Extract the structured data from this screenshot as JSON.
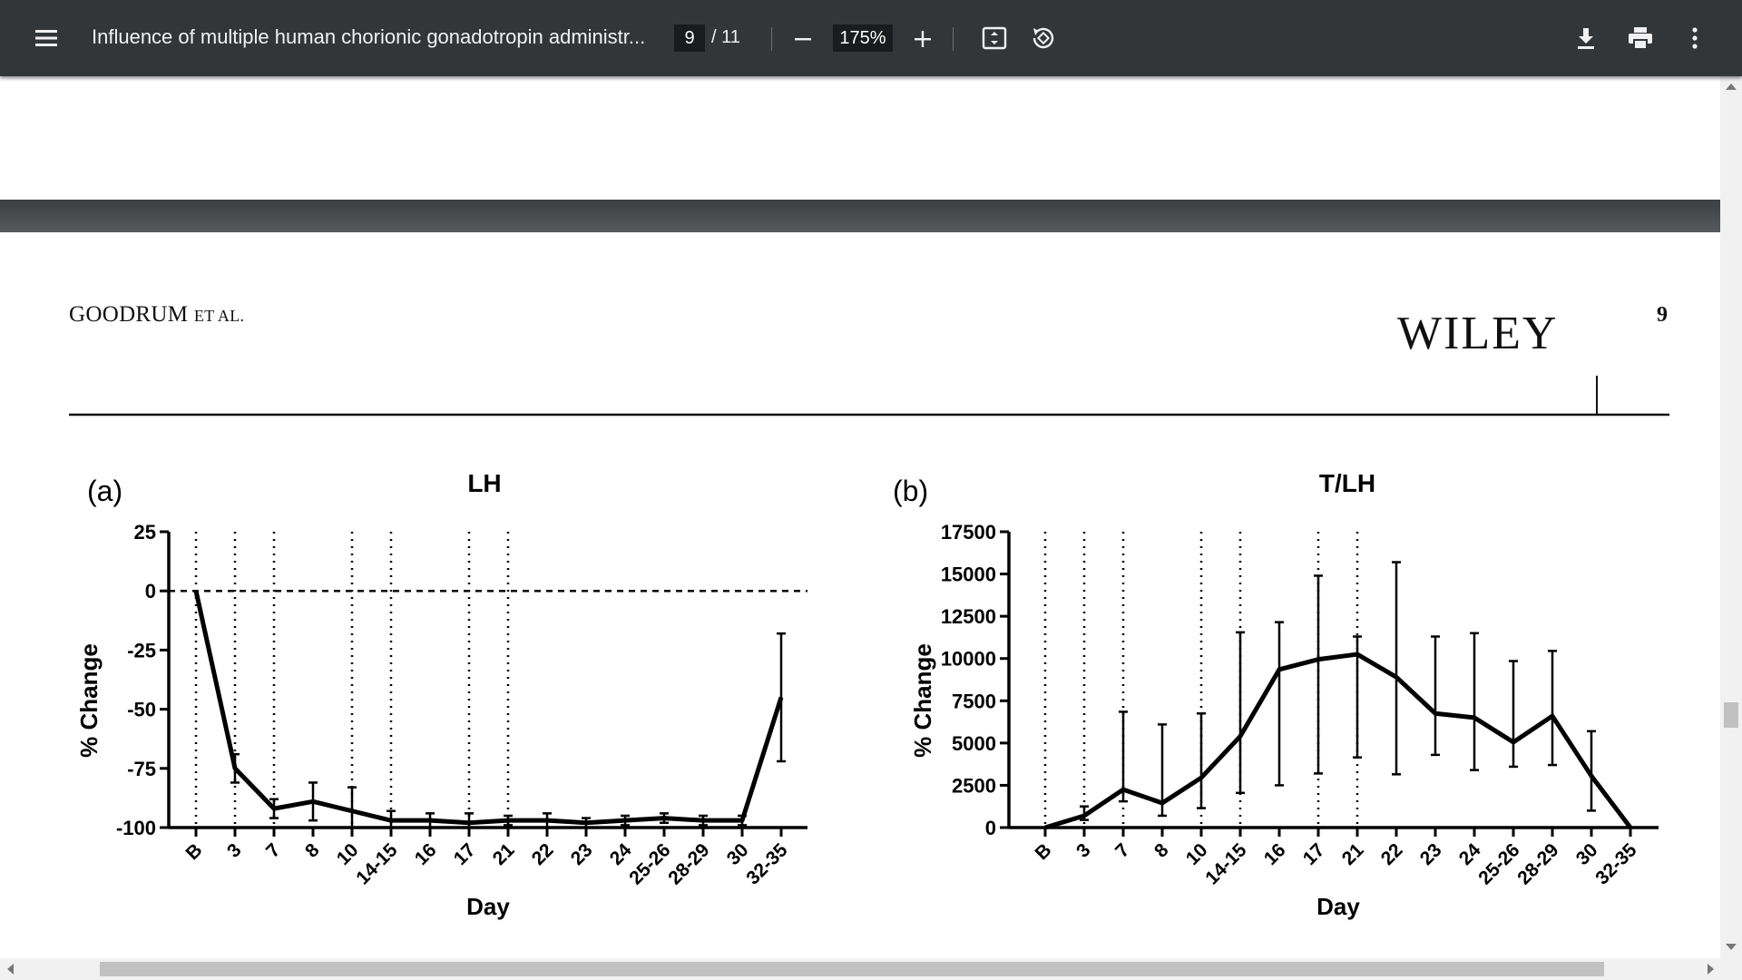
{
  "toolbar": {
    "title": "Influence of multiple human chorionic gonadotropin administr...",
    "page_current": "9",
    "page_total": "/ 11",
    "zoom": "175%",
    "menu_icon": "hamburger-menu-icon",
    "zoom_out_icon": "minus-icon",
    "zoom_in_icon": "plus-icon",
    "fit_icon": "fit-to-page-icon",
    "rotate_icon": "rotate-icon",
    "download_icon": "download-icon",
    "print_icon": "print-icon",
    "more_icon": "more-vertical-icon"
  },
  "page": {
    "running_head_main": "GOODRUM",
    "running_head_small": "ET AL.",
    "publisher": "WILEY",
    "page_number": "9"
  },
  "chart_data": [
    {
      "type": "line",
      "panel_label": "(a)",
      "title": "LH",
      "xlabel": "Day",
      "ylabel": "% Change",
      "categories": [
        "B",
        "3",
        "7",
        "8",
        "10",
        "14-15",
        "16",
        "17",
        "21",
        "22",
        "23",
        "24",
        "25-26",
        "28-29",
        "30",
        "32-35"
      ],
      "values": [
        0,
        -75,
        -92,
        -89,
        -93,
        -97,
        -97,
        -98,
        -97,
        -97,
        -98,
        -97,
        -96,
        -97,
        -97,
        -45
      ],
      "error": [
        0,
        6,
        4,
        8,
        10,
        4,
        3,
        4,
        2,
        3,
        2,
        2,
        2,
        2,
        2,
        27
      ],
      "ylim": [
        -100,
        25
      ],
      "yticks": [
        25,
        0,
        -25,
        -50,
        -75,
        -100
      ],
      "reference_line": 0,
      "vertical_dotted_lines_at": [
        "B",
        "3",
        "7",
        "10",
        "14-15",
        "17",
        "21"
      ]
    },
    {
      "type": "line",
      "panel_label": "(b)",
      "title": "T/LH",
      "xlabel": "Day",
      "ylabel": "% Change",
      "categories": [
        "B",
        "3",
        "7",
        "8",
        "10",
        "14-15",
        "16",
        "17",
        "21",
        "22",
        "23",
        "24",
        "25-26",
        "28-29",
        "30",
        "32-35"
      ],
      "values": [
        0,
        700,
        2250,
        1450,
        2950,
        5400,
        9350,
        9950,
        10250,
        8900,
        6750,
        6500,
        5050,
        6600,
        3050,
        0
      ],
      "error_low": [
        0,
        450,
        1550,
        700,
        1150,
        2050,
        2500,
        3200,
        4150,
        3150,
        4300,
        3400,
        3600,
        3700,
        1000,
        0
      ],
      "error_high": [
        0,
        1250,
        6850,
        6100,
        6750,
        11550,
        12150,
        14900,
        11300,
        15700,
        11300,
        11500,
        9850,
        10450,
        5700,
        0
      ],
      "ylim": [
        0,
        17500
      ],
      "yticks": [
        17500,
        15000,
        12500,
        10000,
        7500,
        5000,
        2500,
        0
      ],
      "vertical_dotted_lines_at": [
        "B",
        "3",
        "7",
        "10",
        "14-15",
        "17",
        "21"
      ]
    }
  ]
}
